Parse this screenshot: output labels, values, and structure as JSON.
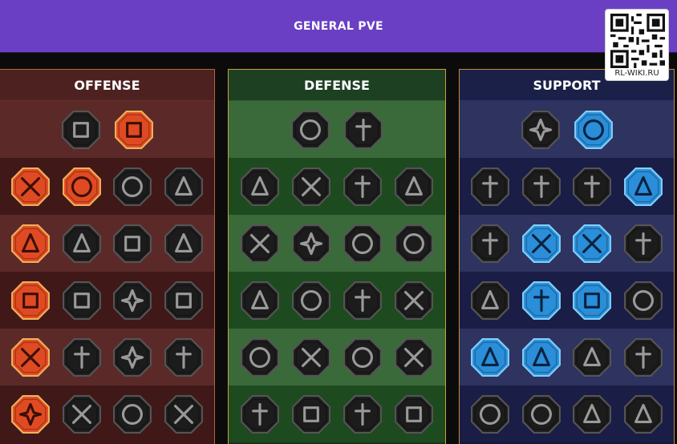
{
  "header": {
    "title": "GENERAL PVE"
  },
  "watermark": {
    "label": "RL-WIKI.RU"
  },
  "colors": {
    "banner": "#6a3fc4",
    "offense_border": "#b5643b",
    "defense_border": "#c5a43c",
    "support_border": "#c88a42",
    "icon_dark": "#1c1c1c",
    "icon_orange": "#e04a22",
    "icon_blue": "#2a8ed8"
  },
  "panels": [
    {
      "key": "offense",
      "title": "OFFENSE",
      "rows": [
        [
          {
            "icon": "crossed-swords-icon",
            "state": "dark"
          },
          {
            "icon": "bloody-dagger-icon",
            "state": "orange"
          }
        ],
        [
          {
            "icon": "horned-demon-icon",
            "state": "orange"
          },
          {
            "icon": "slash-claws-icon",
            "state": "orange"
          },
          {
            "icon": "shield-breaker-icon",
            "state": "dark"
          },
          {
            "icon": "pierced-heart-icon",
            "state": "dark"
          }
        ],
        [
          {
            "icon": "wounded-figure-icon",
            "state": "orange"
          },
          {
            "icon": "fanged-maw-icon",
            "state": "dark"
          },
          {
            "icon": "shattered-skull-icon",
            "state": "dark"
          },
          {
            "icon": "strike-fist-icon",
            "state": "dark"
          }
        ],
        [
          {
            "icon": "flaming-sword-icon",
            "state": "orange"
          },
          {
            "icon": "gauntlet-icon",
            "state": "dark"
          },
          {
            "icon": "battle-axe-icon",
            "state": "dark"
          },
          {
            "icon": "broken-chains-icon",
            "state": "dark"
          }
        ],
        [
          {
            "icon": "bleeding-wound-icon",
            "state": "orange"
          },
          {
            "icon": "skull-icon",
            "state": "dark"
          },
          {
            "icon": "rune-blade-icon",
            "state": "dark"
          },
          {
            "icon": "berserker-icon",
            "state": "dark"
          }
        ],
        [
          {
            "icon": "critical-slash-icon",
            "state": "orange"
          },
          {
            "icon": "knight-helm-icon",
            "state": "dark"
          },
          {
            "icon": "beast-head-icon",
            "state": "dark"
          },
          {
            "icon": "death-knight-icon",
            "state": "dark"
          }
        ]
      ]
    },
    {
      "key": "defense",
      "title": "DEFENSE",
      "rows": [
        [
          {
            "icon": "brick-wall-icon",
            "state": "dark"
          },
          {
            "icon": "raised-fist-icon",
            "state": "dark"
          }
        ],
        [
          {
            "icon": "chevron-shield-icon",
            "state": "dark"
          },
          {
            "icon": "heart-guard-icon",
            "state": "dark"
          },
          {
            "icon": "strongman-icon",
            "state": "dark"
          },
          {
            "icon": "sword-block-icon",
            "state": "dark"
          }
        ],
        [
          {
            "icon": "cloaked-figure-icon",
            "state": "dark"
          },
          {
            "icon": "shield-bearer-icon",
            "state": "dark"
          },
          {
            "icon": "skull-heart-icon",
            "state": "dark"
          },
          {
            "icon": "guardian-bust-icon",
            "state": "dark"
          }
        ],
        [
          {
            "icon": "crowd-icon",
            "state": "dark"
          },
          {
            "icon": "hourglass-icon",
            "state": "dark"
          },
          {
            "icon": "open-palm-icon",
            "state": "dark"
          },
          {
            "icon": "bull-head-icon",
            "state": "dark"
          }
        ],
        [
          {
            "icon": "speed-runner-icon",
            "state": "dark"
          },
          {
            "icon": "claw-marks-icon",
            "state": "dark"
          },
          {
            "icon": "spiked-skull-icon",
            "state": "dark"
          },
          {
            "icon": "swift-arm-icon",
            "state": "dark"
          }
        ],
        [
          {
            "icon": "armored-warrior-icon",
            "state": "dark"
          },
          {
            "icon": "winged-shield-icon",
            "state": "dark"
          },
          {
            "icon": "helmed-face-icon",
            "state": "dark"
          },
          {
            "icon": "muscle-figure-icon",
            "state": "dark"
          }
        ]
      ]
    },
    {
      "key": "support",
      "title": "SUPPORT",
      "rows": [
        [
          {
            "icon": "heart-plus-icon",
            "state": "dark"
          },
          {
            "icon": "energy-target-icon",
            "state": "blue"
          }
        ],
        [
          {
            "icon": "praying-hands-icon",
            "state": "dark"
          },
          {
            "icon": "aura-shield-icon",
            "state": "dark"
          },
          {
            "icon": "smoke-skull-icon",
            "state": "dark"
          },
          {
            "icon": "sweeping-wind-icon",
            "state": "blue"
          }
        ],
        [
          {
            "icon": "blessed-figure-icon",
            "state": "dark"
          },
          {
            "icon": "lightning-icon",
            "state": "blue"
          },
          {
            "icon": "shattered-ground-icon",
            "state": "blue"
          },
          {
            "icon": "shadow-figure-icon",
            "state": "dark"
          }
        ],
        [
          {
            "icon": "chained-heart-icon",
            "state": "dark"
          },
          {
            "icon": "fireball-icon",
            "state": "blue"
          },
          {
            "icon": "open-book-icon",
            "state": "blue"
          },
          {
            "icon": "demon-eyes-icon",
            "state": "dark"
          }
        ],
        [
          {
            "icon": "compass-star-icon",
            "state": "blue"
          },
          {
            "icon": "winged-boot-icon",
            "state": "blue"
          },
          {
            "icon": "all-seeing-eye-icon",
            "state": "dark"
          },
          {
            "icon": "fleeing-figure-icon",
            "state": "dark"
          }
        ],
        [
          {
            "icon": "poison-flask-icon",
            "state": "dark"
          },
          {
            "icon": "crowned-skull-icon",
            "state": "dark"
          },
          {
            "icon": "guarded-fist-icon",
            "state": "dark"
          },
          {
            "icon": "eagle-head-icon",
            "state": "dark"
          }
        ]
      ]
    }
  ]
}
